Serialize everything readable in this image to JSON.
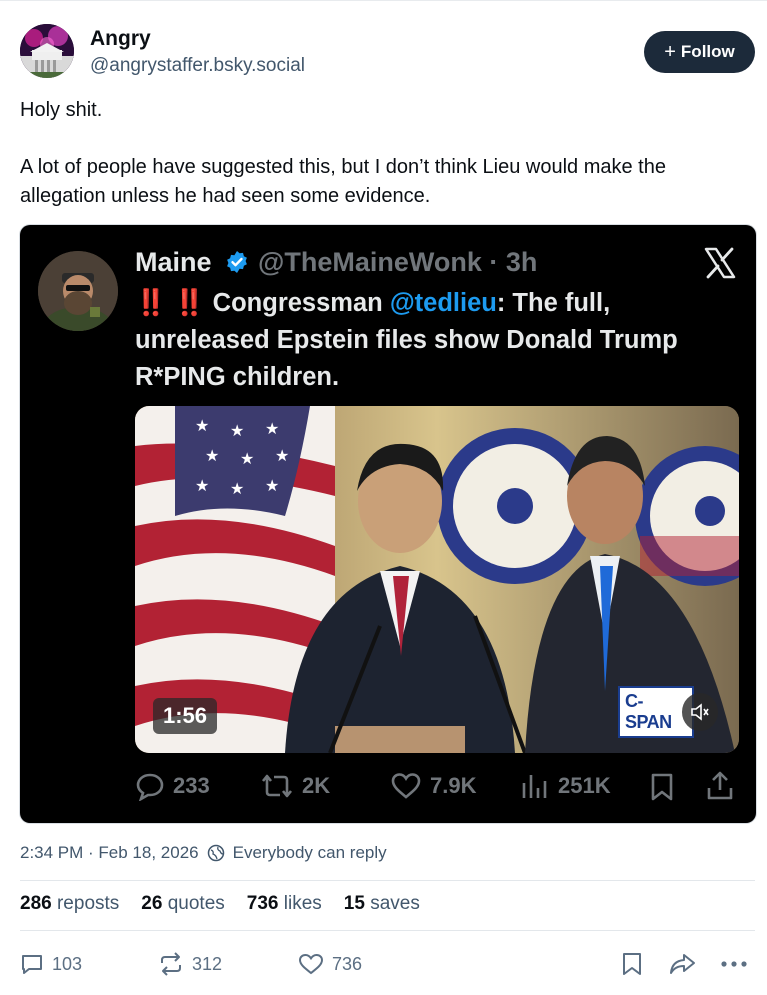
{
  "author": {
    "name": "Angry",
    "handle": "@angrystaffer.bsky.social",
    "follow_label": "Follow"
  },
  "post": {
    "paragraphs": [
      "Holy shit.",
      "A lot of people have suggested this, but I don’t think Lieu would make the allegation unless he had seen some evidence."
    ]
  },
  "embedded_tweet": {
    "name": "Maine",
    "handle": "@TheMaineWonk · 3h",
    "warn": "‼️ ‼️",
    "text_before_mention": " Congressman ",
    "mention": "@tedlieu",
    "text_after_mention": ": The full, unreleased Epstein files show Donald Trump R*PING children.",
    "video_duration": "1:56",
    "video_source": "C-SPAN",
    "replies": "233",
    "reposts": "2K",
    "likes": "7.9K",
    "views": "251K"
  },
  "meta": {
    "timestamp": "2:34 PM · Feb 18, 2026",
    "reply_setting": "Everybody can reply"
  },
  "counts": {
    "reposts_value": "286",
    "reposts_label": "reposts",
    "quotes_value": "26",
    "quotes_label": "quotes",
    "likes_value": "736",
    "likes_label": "likes",
    "saves_value": "15",
    "saves_label": "saves"
  },
  "actions": {
    "replies": "103",
    "reposts": "312",
    "likes": "736"
  },
  "colors": {
    "follow_bg": "#1c2a3a",
    "muted_text": "#42576c",
    "mention_blue": "#1d9bf0",
    "warn_red": "#e0245e"
  }
}
